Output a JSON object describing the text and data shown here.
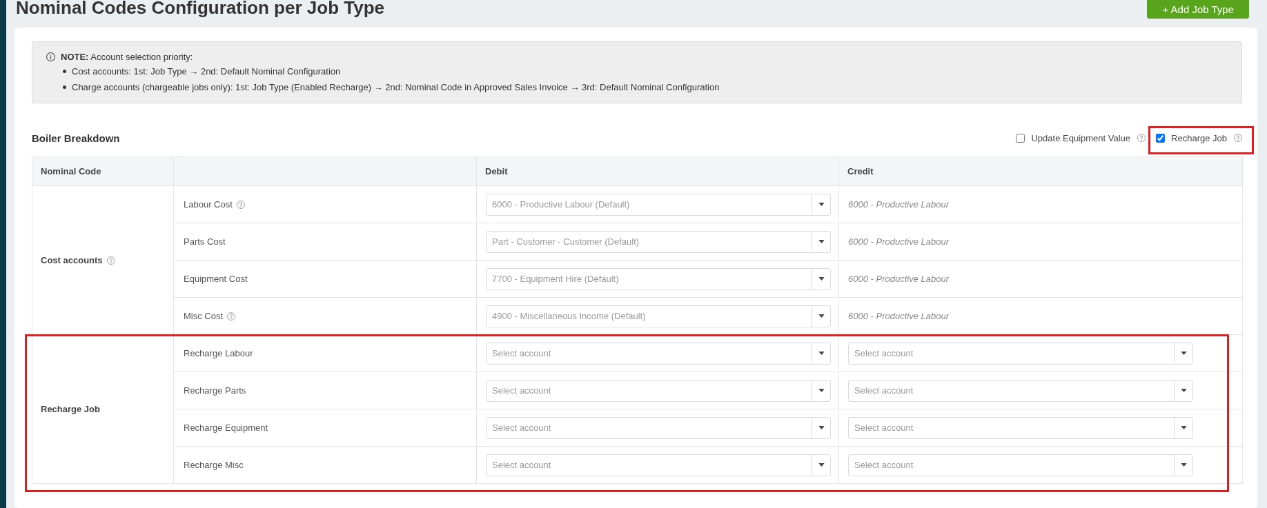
{
  "page": {
    "title": "Nominal Codes Configuration per Job Type",
    "add_button": "+ Add Job Type"
  },
  "note": {
    "heading": "**NOTE:** Account selection priority:",
    "items": [
      "Cost accounts: 1st: Job Type → 2nd: Default Nominal Configuration",
      "Charge accounts (chargeable jobs only): 1st: Job Type (Enabled Recharge) → 2nd: Nominal Code in Approved Sales Invoice → 3rd: Default Nominal Configuration"
    ]
  },
  "section": {
    "title": "Boiler Breakdown",
    "options": [
      {
        "label": "Update Equipment Value",
        "checked": false,
        "help": true,
        "highlighted": false
      },
      {
        "label": "Recharge Job",
        "checked": true,
        "help": true,
        "highlighted": true
      }
    ]
  },
  "table": {
    "headers": {
      "group": "Nominal Code",
      "debit": "Debit",
      "credit": "Credit"
    },
    "groups": [
      {
        "label": "Cost accounts",
        "help": true,
        "highlighted": false,
        "rows": [
          {
            "label": "Labour Cost",
            "help": true,
            "debit": {
              "kind": "select",
              "placeholder": "6000 - Productive Labour (Default)"
            },
            "credit": {
              "kind": "text",
              "text": "6000 - Productive Labour"
            }
          },
          {
            "label": "Parts Cost",
            "help": false,
            "debit": {
              "kind": "select",
              "placeholder": "Part - Customer - Customer (Default)"
            },
            "credit": {
              "kind": "text",
              "text": "6000 - Productive Labour"
            }
          },
          {
            "label": "Equipment Cost",
            "help": false,
            "debit": {
              "kind": "select",
              "placeholder": "7700 - Equipment Hire (Default)"
            },
            "credit": {
              "kind": "text",
              "text": "6000 - Productive Labour"
            }
          },
          {
            "label": "Misc Cost",
            "help": true,
            "debit": {
              "kind": "select",
              "placeholder": "4900 - Miscellaneous Income (Default)"
            },
            "credit": {
              "kind": "text",
              "text": "6000 - Productive Labour"
            }
          }
        ]
      },
      {
        "label": "Recharge Job",
        "help": false,
        "highlighted": true,
        "rows": [
          {
            "label": "Recharge Labour",
            "help": false,
            "debit": {
              "kind": "select",
              "placeholder": "Select account"
            },
            "credit": {
              "kind": "select",
              "placeholder": "Select account"
            }
          },
          {
            "label": "Recharge Parts",
            "help": false,
            "debit": {
              "kind": "select",
              "placeholder": "Select account"
            },
            "credit": {
              "kind": "select",
              "placeholder": "Select account"
            }
          },
          {
            "label": "Recharge Equipment",
            "help": false,
            "debit": {
              "kind": "select",
              "placeholder": "Select account"
            },
            "credit": {
              "kind": "select",
              "placeholder": "Select account"
            }
          },
          {
            "label": "Recharge Misc",
            "help": false,
            "debit": {
              "kind": "select",
              "placeholder": "Select account"
            },
            "credit": {
              "kind": "select",
              "placeholder": "Select account"
            }
          }
        ]
      }
    ]
  }
}
